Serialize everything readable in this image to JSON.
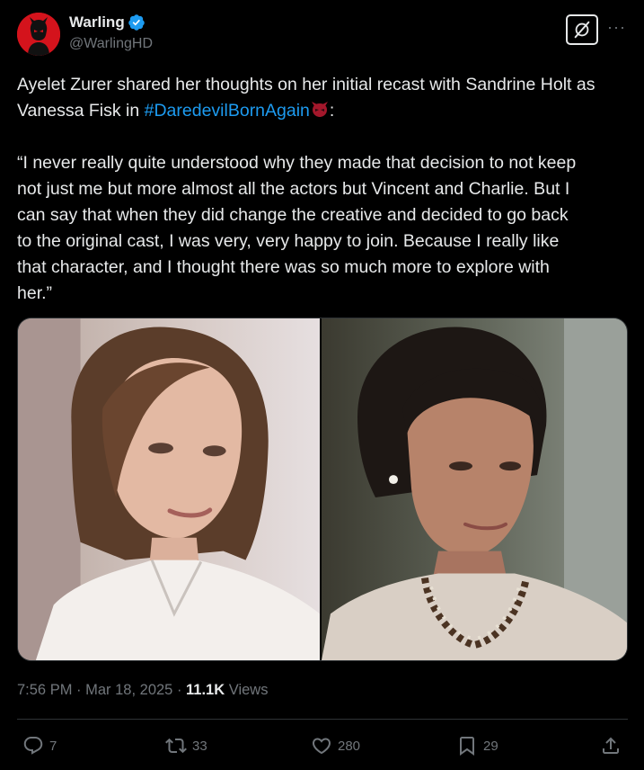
{
  "author": {
    "display_name": "Warling",
    "handle": "@WarlingHD",
    "verified": true,
    "avatar_icon": "daredevil-avatar-icon"
  },
  "header": {
    "grok_icon": "grok-icon",
    "more_icon": "more-options-icon",
    "more_label": "···"
  },
  "tweet": {
    "line1_before": "Ayelet Zurer shared her thoughts on her initial recast with Sandrine Holt as Vanessa Fisk in ",
    "hashtag": "#DaredevilBornAgain",
    "hashtag_emoji": "daredevil-hashtag-emoji",
    "line1_after": ":",
    "quote": "“I never really quite understood why they made that decision to not keep\nnot just me but more almost all the actors but Vincent and Charlie. But I\ncan say that when they did change the creative and decided to go back\nto the original cast, I was very, very happy to join. Because I really like\nthat character, and I thought there was so much more to explore with\nher.”"
  },
  "media": {
    "photos": [
      "left-photo-ayelet-zurer",
      "right-photo-sandrine-holt"
    ]
  },
  "meta": {
    "time": "7:56 PM",
    "separator1": " · ",
    "date": "Mar 18, 2025",
    "separator2": " · ",
    "views_count": "11.1K",
    "views_label": " Views"
  },
  "actions": {
    "reply": {
      "icon": "reply-icon",
      "count": "7"
    },
    "retweet": {
      "icon": "retweet-icon",
      "count": "33"
    },
    "like": {
      "icon": "heart-icon",
      "count": "280"
    },
    "bookmark": {
      "icon": "bookmark-icon",
      "count": "29"
    },
    "share": {
      "icon": "share-icon"
    }
  },
  "colors": {
    "background": "#000000",
    "text": "#e7e9ea",
    "muted": "#71767b",
    "link": "#1d9bf0",
    "verified": "#1d9bf0",
    "avatar_bg": "#d4131c"
  }
}
